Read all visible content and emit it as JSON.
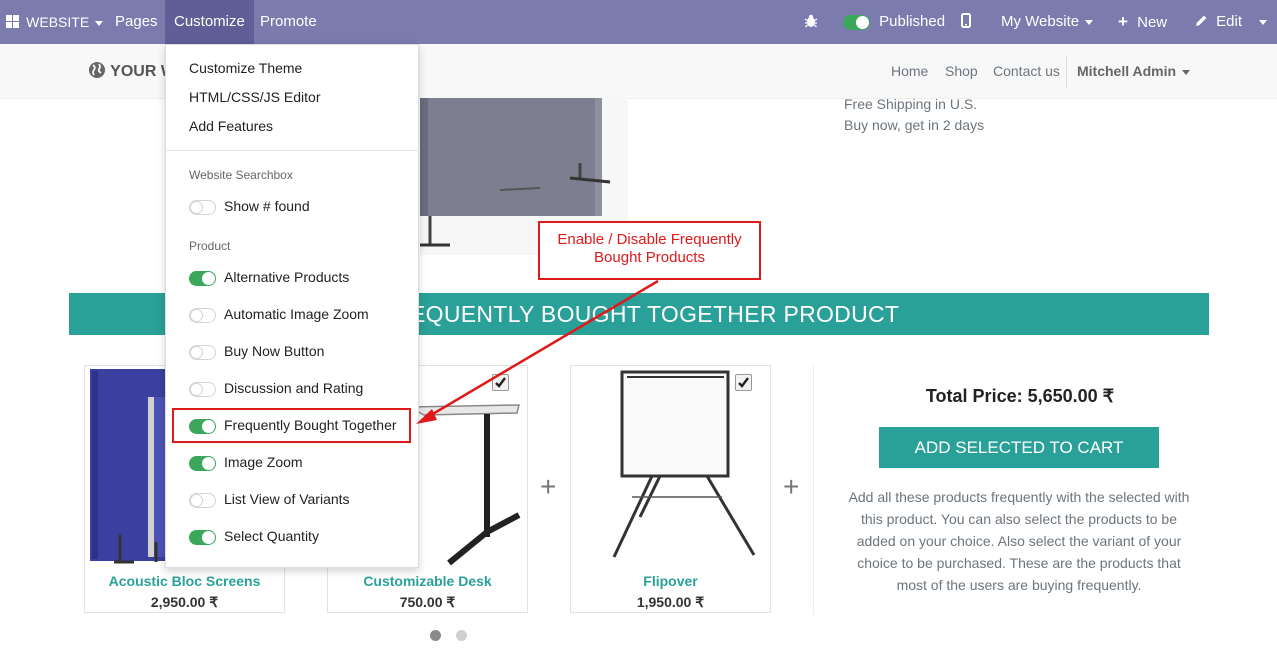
{
  "topbar": {
    "app_menu": "WEBSITE",
    "pages": "Pages",
    "customize": "Customize",
    "promote": "Promote",
    "published": "Published",
    "website_selector": "My Website",
    "new": "New",
    "edit": "Edit"
  },
  "site_header": {
    "logo_text": "YOUR W",
    "nav": [
      "Home",
      "Shop",
      "Contact us"
    ],
    "user": "Mitchell Admin"
  },
  "shipping": [
    "Free Shipping in U.S.",
    "Buy now, get in 2 days"
  ],
  "dropdown": {
    "items": [
      "Customize Theme",
      "HTML/CSS/JS Editor",
      "Add Features"
    ],
    "section_searchbox": "Website Searchbox",
    "searchbox_toggles": [
      {
        "label": "Show # found",
        "enabled": false
      }
    ],
    "section_product": "Product",
    "product_toggles": [
      {
        "label": "Alternative Products",
        "enabled": true
      },
      {
        "label": "Automatic Image Zoom",
        "enabled": false
      },
      {
        "label": "Buy Now Button",
        "enabled": false
      },
      {
        "label": "Discussion and Rating",
        "enabled": false
      },
      {
        "label": "Frequently Bought Together",
        "enabled": true
      },
      {
        "label": "Image Zoom",
        "enabled": true
      },
      {
        "label": "List View of Variants",
        "enabled": false
      },
      {
        "label": "Select Quantity",
        "enabled": true
      }
    ]
  },
  "callout": {
    "line1": "Enable / Disable Frequently",
    "line2": "Bought Products"
  },
  "fbt": {
    "banner": "FREQUENTLY BOUGHT TOGETHER PRODUCT",
    "products": [
      {
        "name": "Acoustic Bloc Screens",
        "price": "2,950.00 ₹"
      },
      {
        "name": "Customizable Desk",
        "price": "750.00 ₹"
      },
      {
        "name": "Flipover",
        "price": "1,950.00 ₹"
      }
    ],
    "total": "Total Price: 5,650.00 ₹",
    "cart_button": "ADD SELECTED TO CART",
    "description": "Add all these products frequently with the selected with this product. You can also select the products to be added on your choice. Also select the variant of your choice to be purchased. These are the products that most of the users are buying frequently."
  },
  "colors": {
    "admin_bar": "#7c7bad",
    "teal": "#2aa198",
    "annotation_red": "#e0191b",
    "toggle_on": "#3aa75a"
  }
}
